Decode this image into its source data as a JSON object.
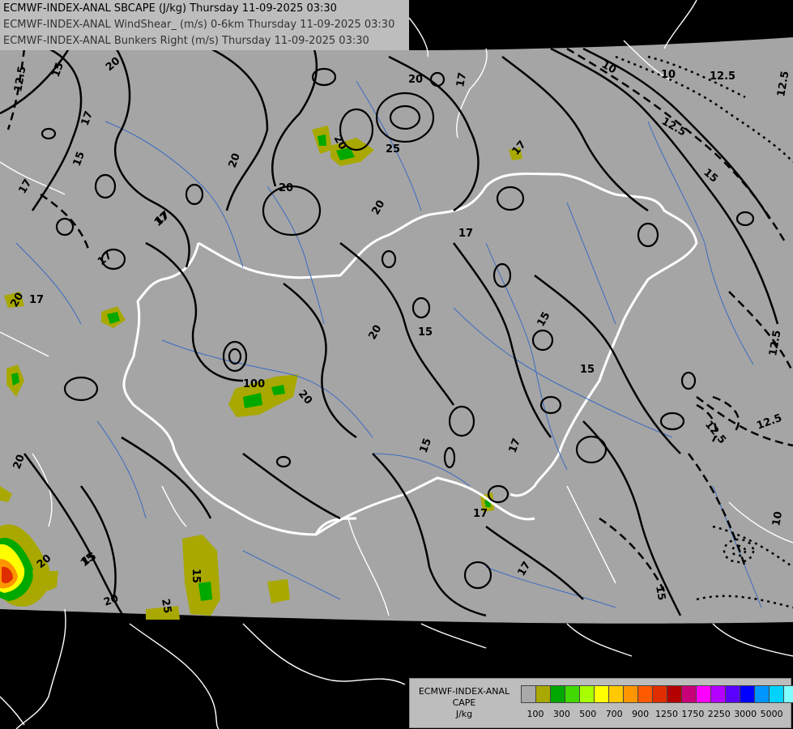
{
  "header": {
    "line1": "ECMWF-INDEX-ANAL SBCAPE (J/kg) Thursday 11-09-2025 03:30",
    "line2": "ECMWF-INDEX-ANAL WindShear_ (m/s) 0-6km Thursday 11-09-2025 03:30",
    "line3": "ECMWF-INDEX-ANAL Bunkers Right (m/s) Thursday 11-09-2025 03:30"
  },
  "legend": {
    "title_line1": "ECMWF-INDEX-ANAL",
    "title_line2": "CAPE",
    "title_line3": "J/kg",
    "colors": [
      "#a9a9a9",
      "#a8a800",
      "#00a800",
      "#41d900",
      "#a8ff00",
      "#ffff00",
      "#ffc800",
      "#ff9600",
      "#ff5a00",
      "#e02d00",
      "#b40000",
      "#c80078",
      "#ff00ff",
      "#b400ff",
      "#5a00ff",
      "#0000ff",
      "#0096ff",
      "#00d2ff",
      "#7fffff",
      "#ffffff"
    ],
    "tick_labels": [
      "100",
      "300",
      "500",
      "700",
      "900",
      "1250",
      "1750",
      "2250",
      "3000",
      "5000"
    ]
  },
  "contour_labels": [
    "12.5",
    "15",
    "20",
    "17",
    "17",
    "20",
    "17",
    "20",
    "20",
    "20",
    "25",
    "20",
    "20",
    "17",
    "17",
    "15",
    "15",
    "10",
    "10",
    "12.5",
    "12.5",
    "15",
    "17",
    "17",
    "17",
    "20",
    "20",
    "17",
    "15",
    "15",
    "15",
    "100",
    "20",
    "20",
    "15",
    "15",
    "17",
    "17",
    "17",
    "15",
    "12.5",
    "12.5",
    "12.5",
    "12.5",
    "20",
    "15",
    "20",
    "25",
    "100",
    "20",
    "15",
    "15",
    "10"
  ]
}
